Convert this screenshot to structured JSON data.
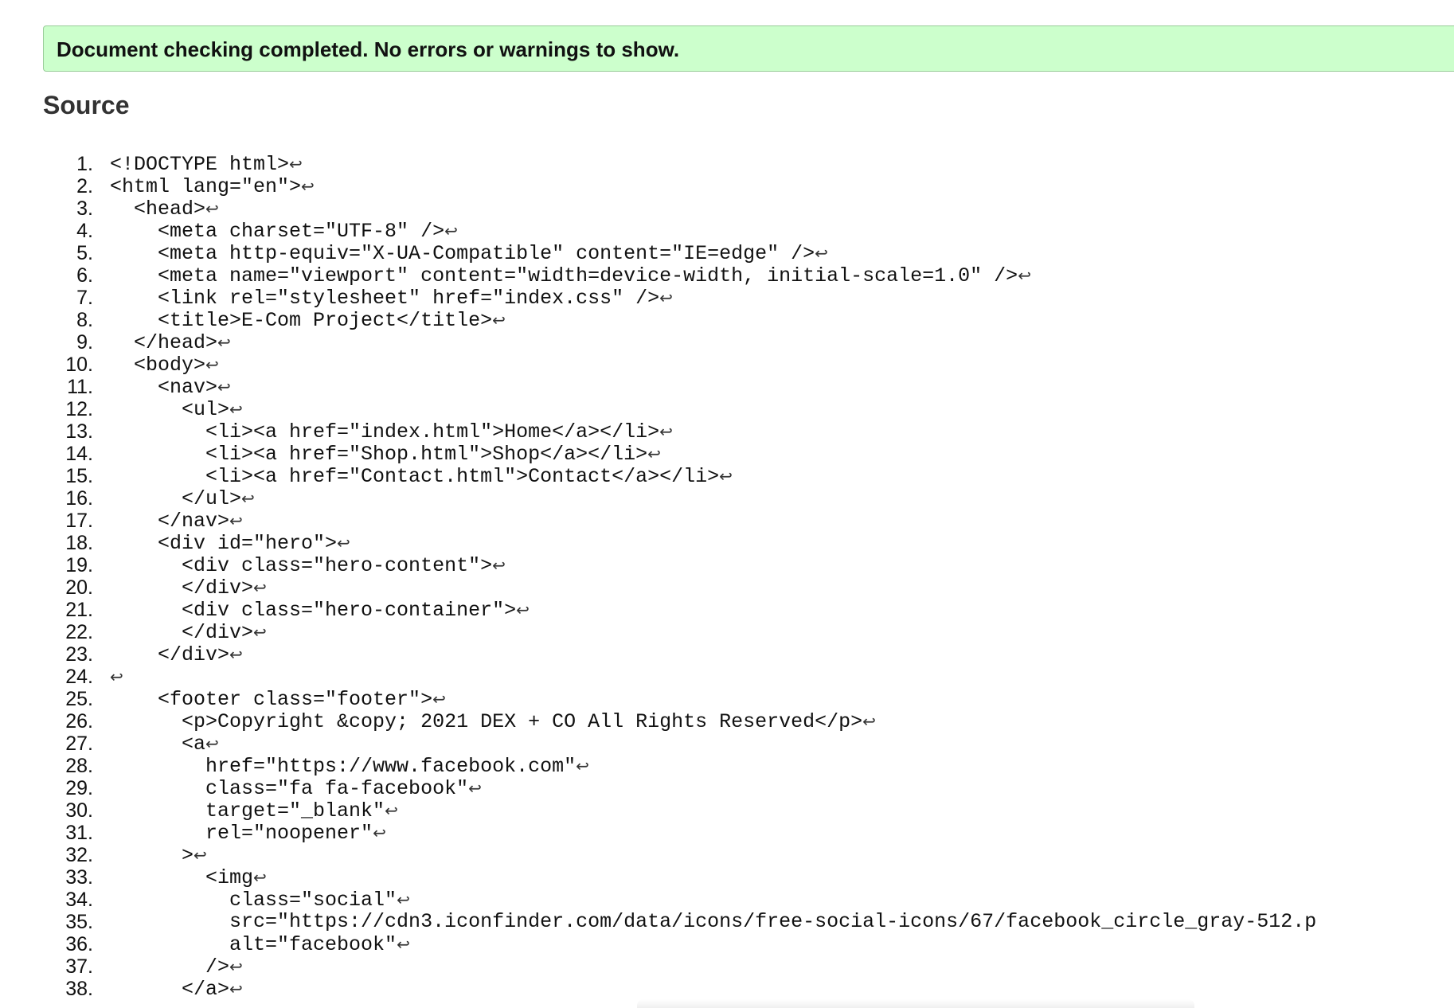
{
  "status": {
    "message": "Document checking completed. No errors or warnings to show."
  },
  "source": {
    "heading": "Source",
    "return_symbol": "↩",
    "lines": [
      {
        "num": "1.",
        "code": "<!DOCTYPE html>"
      },
      {
        "num": "2.",
        "code": "<html lang=\"en\">"
      },
      {
        "num": "3.",
        "code": "  <head>"
      },
      {
        "num": "4.",
        "code": "    <meta charset=\"UTF-8\" />"
      },
      {
        "num": "5.",
        "code": "    <meta http-equiv=\"X-UA-Compatible\" content=\"IE=edge\" />"
      },
      {
        "num": "6.",
        "code": "    <meta name=\"viewport\" content=\"width=device-width, initial-scale=1.0\" />"
      },
      {
        "num": "7.",
        "code": "    <link rel=\"stylesheet\" href=\"index.css\" />"
      },
      {
        "num": "8.",
        "code": "    <title>E-Com Project</title>"
      },
      {
        "num": "9.",
        "code": "  </head>"
      },
      {
        "num": "10.",
        "code": "  <body>"
      },
      {
        "num": "11.",
        "code": "    <nav>"
      },
      {
        "num": "12.",
        "code": "      <ul>"
      },
      {
        "num": "13.",
        "code": "        <li><a href=\"index.html\">Home</a></li>"
      },
      {
        "num": "14.",
        "code": "        <li><a href=\"Shop.html\">Shop</a></li>"
      },
      {
        "num": "15.",
        "code": "        <li><a href=\"Contact.html\">Contact</a></li>"
      },
      {
        "num": "16.",
        "code": "      </ul>"
      },
      {
        "num": "17.",
        "code": "    </nav>"
      },
      {
        "num": "18.",
        "code": "    <div id=\"hero\">"
      },
      {
        "num": "19.",
        "code": "      <div class=\"hero-content\">"
      },
      {
        "num": "20.",
        "code": "      </div>"
      },
      {
        "num": "21.",
        "code": "      <div class=\"hero-container\">"
      },
      {
        "num": "22.",
        "code": "      </div>"
      },
      {
        "num": "23.",
        "code": "    </div>"
      },
      {
        "num": "24.",
        "code": ""
      },
      {
        "num": "25.",
        "code": "    <footer class=\"footer\">"
      },
      {
        "num": "26.",
        "code": "      <p>Copyright &copy; 2021 DEX + CO All Rights Reserved</p>"
      },
      {
        "num": "27.",
        "code": "      <a"
      },
      {
        "num": "28.",
        "code": "        href=\"https://www.facebook.com\""
      },
      {
        "num": "29.",
        "code": "        class=\"fa fa-facebook\""
      },
      {
        "num": "30.",
        "code": "        target=\"_blank\""
      },
      {
        "num": "31.",
        "code": "        rel=\"noopener\""
      },
      {
        "num": "32.",
        "code": "      >"
      },
      {
        "num": "33.",
        "code": "        <img"
      },
      {
        "num": "34.",
        "code": "          class=\"social\""
      },
      {
        "num": "35.",
        "code": "          src=\"https://cdn3.iconfinder.com/data/icons/free-social-icons/67/facebook_circle_gray-512.p",
        "truncated": true
      },
      {
        "num": "36.",
        "code": "          alt=\"facebook\""
      },
      {
        "num": "37.",
        "code": "        />"
      },
      {
        "num": "38.",
        "code": "      </a>"
      }
    ]
  }
}
